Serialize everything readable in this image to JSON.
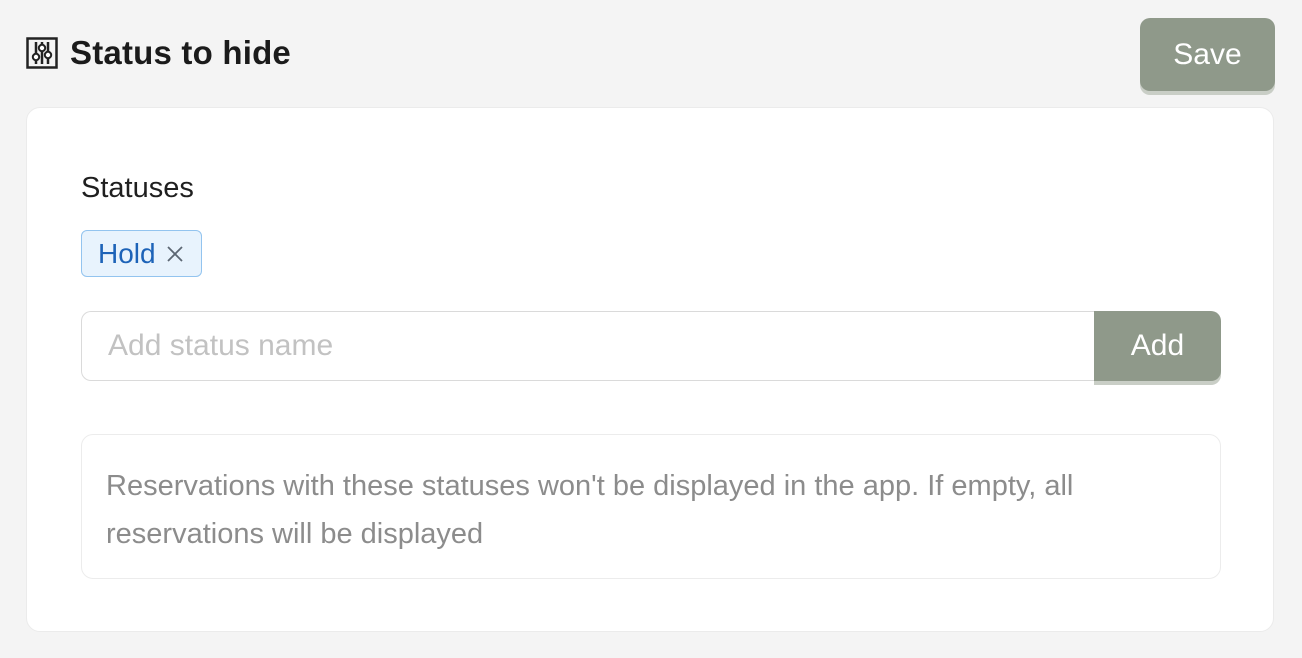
{
  "header": {
    "title": "Status to hide",
    "title_icon": "sliders-icon",
    "save_label": "Save"
  },
  "form": {
    "statuses_label": "Statuses",
    "tags": [
      {
        "label": "Hold",
        "remove_icon": "close-icon"
      }
    ],
    "input_placeholder": "Add status name",
    "input_value": "",
    "add_label": "Add"
  },
  "help": {
    "text": "Reservations with these statuses won't be displayed in the app. If empty, all reservations will be displayed"
  },
  "colors": {
    "background": "#f4f4f4",
    "button": "#8f998a",
    "tag_background": "#e8f3fd",
    "tag_border": "#93c4ef",
    "tag_text": "#1d63b8"
  }
}
